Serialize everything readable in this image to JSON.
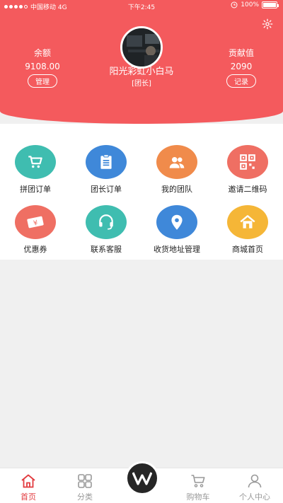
{
  "status_bar": {
    "carrier": "中国移动 4G",
    "time": "下午2:45",
    "battery": "100%"
  },
  "profile": {
    "username": "阳光彩虹小白马",
    "role": "[团长]",
    "balance_label": "余额",
    "balance_value": "9108.00",
    "balance_button": "管理",
    "contribution_label": "贡献值",
    "contribution_value": "2090",
    "contribution_button": "记录"
  },
  "menu": [
    {
      "label": "拼团订单",
      "icon": "cart-icon",
      "color": "#3fbdb0"
    },
    {
      "label": "团长订单",
      "icon": "clipboard-icon",
      "color": "#3f88d9"
    },
    {
      "label": "我的团队",
      "icon": "team-icon",
      "color": "#f08b4b"
    },
    {
      "label": "邀请二维码",
      "icon": "qrcode-icon",
      "color": "#ef6f63"
    },
    {
      "label": "优惠券",
      "icon": "coupon-icon",
      "color": "#ef6f63"
    },
    {
      "label": "联系客服",
      "icon": "headset-icon",
      "color": "#3fbdb0"
    },
    {
      "label": "收货地址管理",
      "icon": "location-pin-icon",
      "color": "#3f88d9"
    },
    {
      "label": "商城首页",
      "icon": "home-icon",
      "color": "#f5b637"
    }
  ],
  "tabs": [
    {
      "label": "首页",
      "icon": "home-outline-icon",
      "active": true
    },
    {
      "label": "分类",
      "icon": "grid-icon"
    },
    {
      "label": "",
      "icon": "brand-logo-icon"
    },
    {
      "label": "购物车",
      "icon": "cart-outline-icon"
    },
    {
      "label": "个人中心",
      "icon": "person-icon"
    }
  ],
  "colors": {
    "header": "#f45a5d",
    "active_tab": "#e23b3f"
  }
}
